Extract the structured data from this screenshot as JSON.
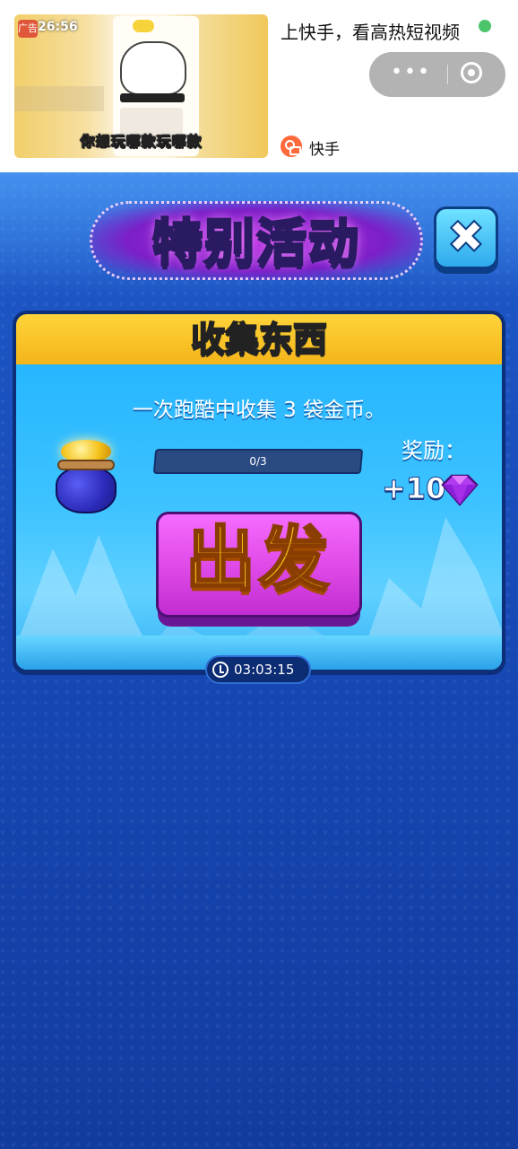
{
  "ad": {
    "thumb_caption": "你想玩哪款玩哪款",
    "thumb_label": "广告",
    "thumb_time": "26:56",
    "title": "上快手，看高热短视频",
    "brand_name": "快手",
    "icons": [
      "more-dots-icon",
      "target-close-icon",
      "kuaishou-logo"
    ]
  },
  "event": {
    "title": "特别活动",
    "close_icon": "close-x-icon",
    "card_title": "收集东西",
    "description": "一次跑酷中收集 3 袋金币。",
    "progress_text": "0/3",
    "progress_value": 0,
    "progress_max": 3,
    "reward_label": "奖励：",
    "reward_value": "+10",
    "reward_icon": "purple-gem-icon",
    "item_icon": "gold-coin-bag-icon",
    "go_button": "出发",
    "timer": "03:03:15"
  },
  "colors": {
    "background_blue": "#1646b2",
    "title_yellow": "#ffd640",
    "header_yellow": "#f3b51a",
    "card_cyan": "#3cc2ff",
    "go_button_magenta": "#e04be8",
    "progress_green": "#41e06a"
  }
}
